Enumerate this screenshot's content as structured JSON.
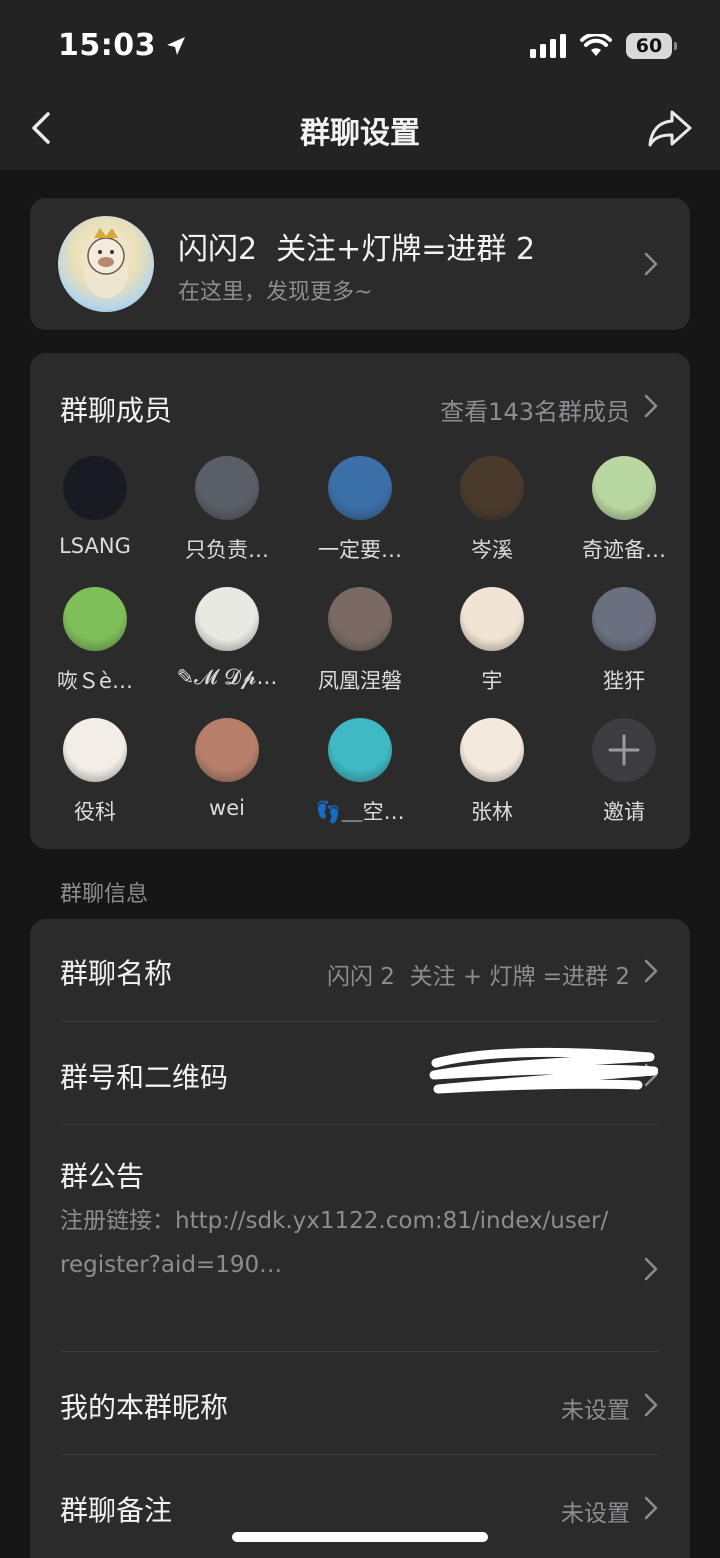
{
  "status_bar": {
    "time": "15:03",
    "battery": "60"
  },
  "nav": {
    "title": "群聊设置"
  },
  "group": {
    "name": "闪闪2  关注+灯牌=进群 2",
    "subtitle": "在这里，发现更多~"
  },
  "members": {
    "title": "群聊成员",
    "view_all": "查看143名群成员",
    "items": [
      {
        "name": "LSANG",
        "color": "#1a1a22"
      },
      {
        "name": "只负责…",
        "color": "#5a5e66"
      },
      {
        "name": "一定要…",
        "color": "#3b6fa8"
      },
      {
        "name": "岑溪",
        "color": "#4a3a2c"
      },
      {
        "name": "奇迹备…",
        "color": "#b9d7a0"
      },
      {
        "name": "咴Ｓè…",
        "color": "#7fbf5a"
      },
      {
        "name": "✎𝓜 𝓓𝓹…",
        "color": "#e9e9e4"
      },
      {
        "name": "凤凰涅磐",
        "color": "#7a6a63"
      },
      {
        "name": "宇",
        "color": "#f1e4d4"
      },
      {
        "name": "狴犴",
        "color": "#6b7080"
      },
      {
        "name": "役科",
        "color": "#f2eee7"
      },
      {
        "name": "wei",
        "color": "#b77e6a"
      },
      {
        "name": "👣＿空…",
        "color": "#3fb9c4"
      },
      {
        "name": "张林",
        "color": "#f3e9dd"
      },
      {
        "name": "邀请",
        "color": "#3d3d3f"
      }
    ]
  },
  "info_section_label": "群聊信息",
  "info": {
    "name_label": "群聊名称",
    "name_value": "闪闪 2  关注 + 灯牌 =进群 2",
    "code_label": "群号和二维码",
    "notice_label": "群公告",
    "notice_text": "注册链接：http://sdk.yx1122.com:81/index/user/register?aid=190…",
    "nickname_label": "我的本群昵称",
    "nickname_value": "未设置",
    "remark_label": "群聊备注",
    "remark_value": "未设置"
  }
}
